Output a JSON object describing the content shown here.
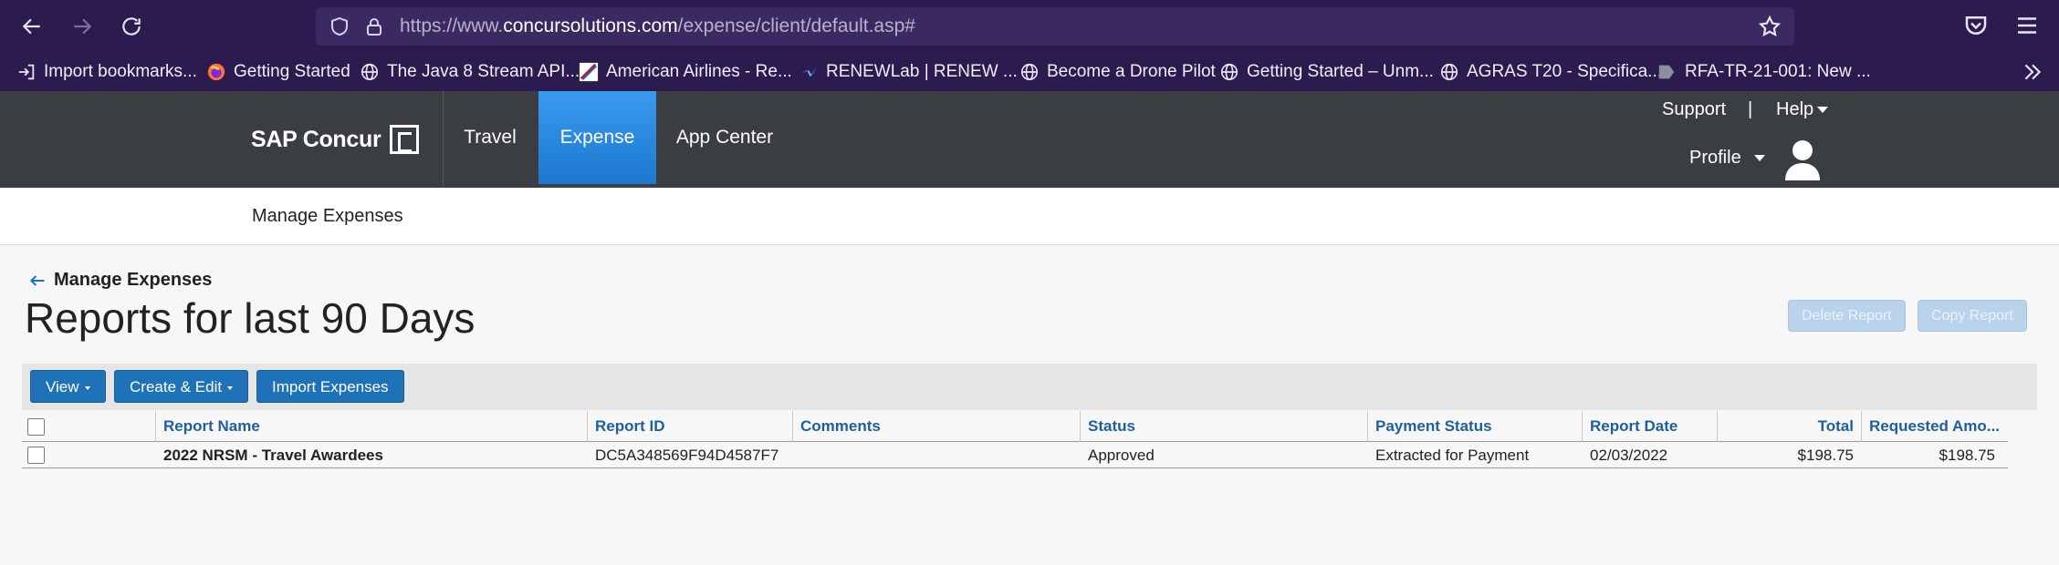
{
  "browser": {
    "url_prefix": "https://www.",
    "url_domain": "concursolutions.com",
    "url_path": "/expense/client/default.asp#",
    "bookmarks": [
      {
        "label": "Import bookmarks...",
        "icon": "import-icon"
      },
      {
        "label": "Getting Started",
        "icon": "firefox-icon"
      },
      {
        "label": "The Java 8 Stream API...",
        "icon": "globe-icon"
      },
      {
        "label": "American Airlines - Re...",
        "icon": "american-airlines-icon"
      },
      {
        "label": "RENEWLab | RENEW ...",
        "icon": "renew-icon"
      },
      {
        "label": "Become a Drone Pilot",
        "icon": "globe-icon"
      },
      {
        "label": "Getting Started – Unm...",
        "icon": "globe-icon"
      },
      {
        "label": "AGRAS T20 - Specifica...",
        "icon": "globe-icon"
      },
      {
        "label": "RFA-TR-21-001: New ...",
        "icon": "document-tag-icon"
      }
    ]
  },
  "header": {
    "logo": "SAP Concur",
    "tabs": [
      {
        "label": "Travel",
        "active": false
      },
      {
        "label": "Expense",
        "active": true
      },
      {
        "label": "App Center",
        "active": false
      }
    ],
    "support": "Support",
    "separator": "|",
    "help": "Help",
    "profile": "Profile"
  },
  "subnav": {
    "item": "Manage Expenses"
  },
  "page": {
    "back_label": "Manage Expenses",
    "title": "Reports for last 90 Days",
    "delete_report": "Delete Report",
    "copy_report": "Copy Report"
  },
  "toolbar": {
    "view": "View",
    "create_edit": "Create & Edit",
    "import_expenses": "Import Expenses"
  },
  "table": {
    "columns": {
      "report_name": "Report Name",
      "report_id": "Report ID",
      "comments": "Comments",
      "status": "Status",
      "payment_status": "Payment Status",
      "report_date": "Report Date",
      "total": "Total",
      "requested_amount": "Requested Amo..."
    },
    "rows": [
      {
        "report_name": "2022 NRSM - Travel Awardees",
        "report_id": "DC5A348569F94D4587F7",
        "comments": "",
        "status": "Approved",
        "payment_status": "Extracted for Payment",
        "report_date": "02/03/2022",
        "total": "$198.75",
        "requested_amount": "$198.75"
      }
    ]
  },
  "colors": {
    "browser_bg": "#2b1b4f",
    "header_bg": "#3a3d42",
    "active_tab": "#2d8ce0",
    "button_blue": "#1f72b8",
    "link_blue": "#1f5f9e"
  }
}
